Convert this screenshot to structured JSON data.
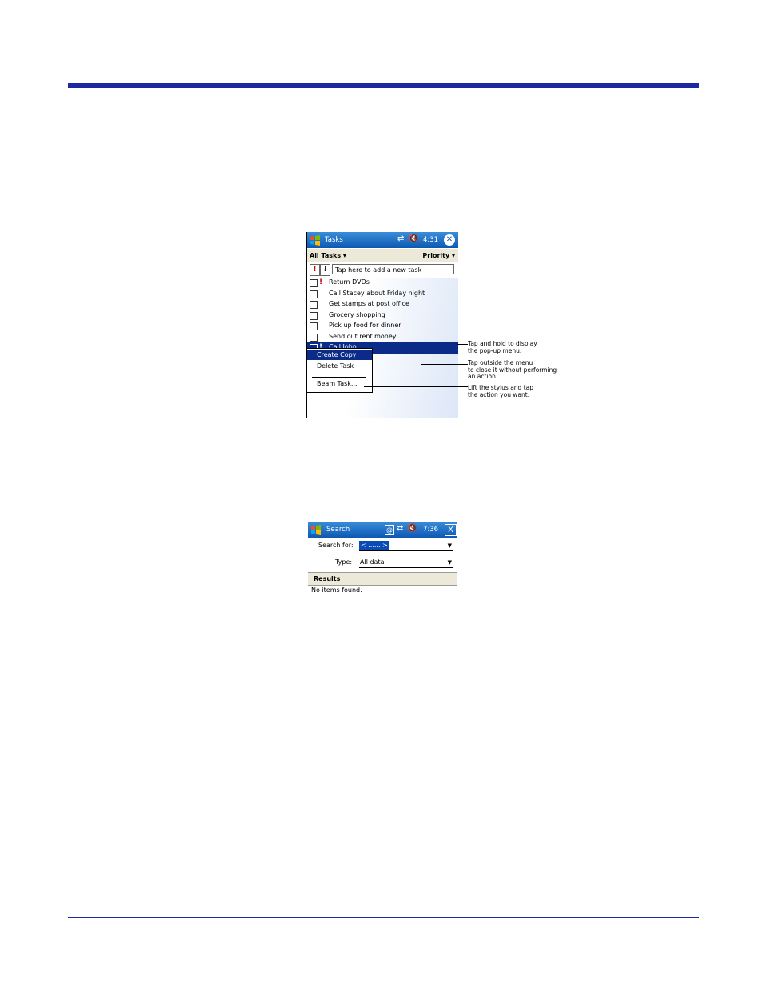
{
  "tasks_screen": {
    "title": "Tasks",
    "time": "4:31",
    "close_glyph": "✕",
    "sync_icon": "⇄",
    "speaker_icon": "🔇",
    "filter_label": "All Tasks ▾",
    "sort_label": "Priority ▾",
    "priority_button": "!",
    "sort_button": "↓",
    "new_task_placeholder": "Tap here to add a new task",
    "tasks": [
      {
        "label": "Return DVDs",
        "priority": "!"
      },
      {
        "label": "Call Stacey about Friday night",
        "priority": ""
      },
      {
        "label": "Get stamps at post office",
        "priority": ""
      },
      {
        "label": "Grocery shopping",
        "priority": ""
      },
      {
        "label": "Pick up food for dinner",
        "priority": ""
      },
      {
        "label": "Send out rent money",
        "priority": ""
      },
      {
        "label": "Call John",
        "priority": "!"
      }
    ],
    "popup_menu": [
      "Create Copy",
      "Delete Task",
      "Beam Task..."
    ]
  },
  "callouts": {
    "hold": [
      "Tap and hold to display",
      "the pop-up menu."
    ],
    "outside": [
      "Tap outside the menu",
      "to close it without performing",
      "an action."
    ],
    "lift": [
      "Lift the stylus and tap",
      "the action you want."
    ]
  },
  "search_screen": {
    "title": "Search",
    "time": "7:36",
    "at_glyph": "@",
    "close_glyph": "X",
    "sync_icon": "⇄",
    "speaker_icon": "🔇",
    "search_for_label": "Search for:",
    "search_for_value": "< ...... >",
    "type_label": "Type:",
    "type_value": "All data",
    "results_header": "Results",
    "results_text": "No items found."
  },
  "colors": {
    "rule": "#1e28a0",
    "titlebar": "#0c58b4",
    "selection": "#0a2c88"
  }
}
